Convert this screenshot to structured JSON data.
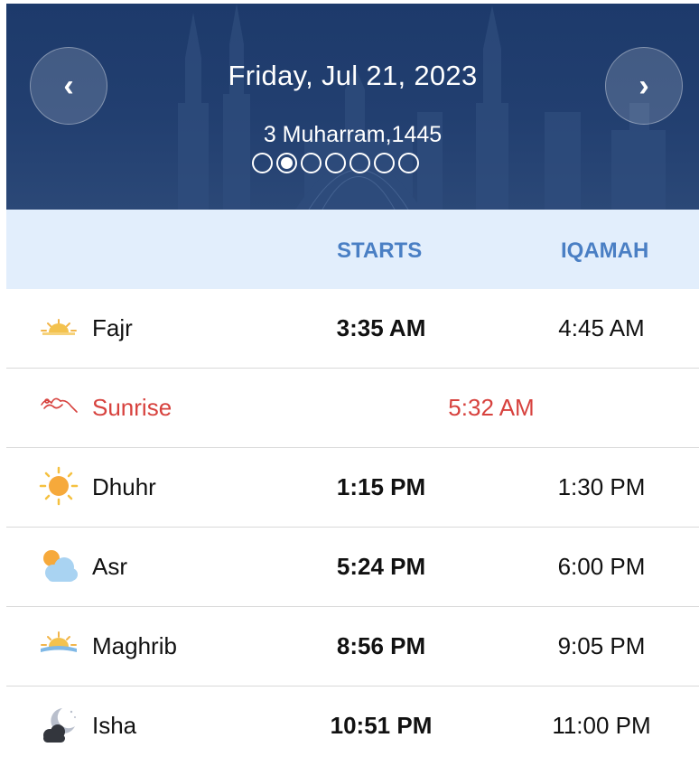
{
  "header": {
    "prev_icon": "chevron-left-icon",
    "next_icon": "chevron-right-icon",
    "prev_label": "‹",
    "next_label": "›",
    "date": "Friday, Jul 21, 2023",
    "hijri_date": "3 Muharram,1445",
    "page_dots": {
      "count": 7,
      "active_index": 1
    }
  },
  "columns": {
    "starts": "STARTS",
    "iqamah": "IQAMAH"
  },
  "prayers": [
    {
      "name": "Fajr",
      "icon": "sunrise-dawn-icon",
      "starts": "3:35 AM",
      "iqamah": "4:45 AM"
    },
    {
      "name": "Sunrise",
      "icon": "bird-icon",
      "time": "5:32 AM",
      "highlight_color": "#d7423e"
    },
    {
      "name": "Dhuhr",
      "icon": "sun-icon",
      "starts": "1:15 PM",
      "iqamah": "1:30 PM"
    },
    {
      "name": "Asr",
      "icon": "sun-behind-cloud-icon",
      "starts": "5:24 PM",
      "iqamah": "6:00 PM"
    },
    {
      "name": "Maghrib",
      "icon": "sunset-icon",
      "starts": "8:56 PM",
      "iqamah": "9:05 PM"
    },
    {
      "name": "Isha",
      "icon": "moon-cloud-icon",
      "starts": "10:51 PM",
      "iqamah": "11:00 PM"
    }
  ],
  "colors": {
    "header_bg": "#1d3a6b",
    "column_header_bg": "#e2eefc",
    "column_header_text": "#4a7fc4",
    "sunrise": "#d7423e"
  }
}
